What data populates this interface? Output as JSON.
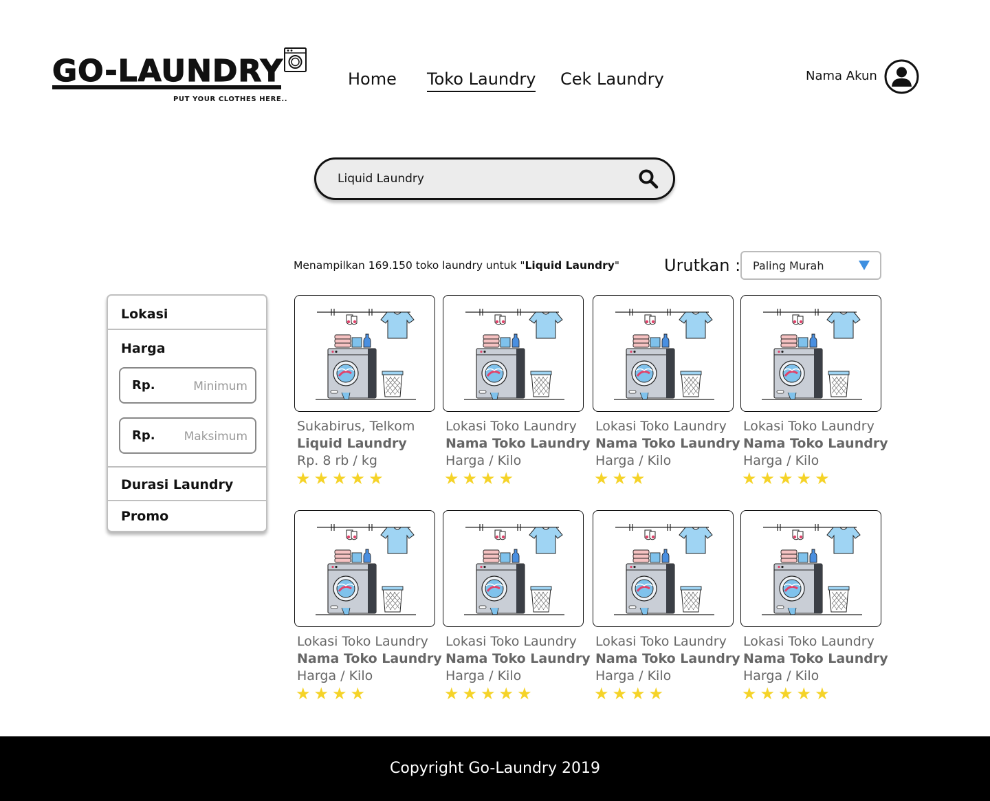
{
  "logo": {
    "brand": "GO-LAUNDRY",
    "tagline": "PUT YOUR CLOTHES HERE.."
  },
  "nav": {
    "items": [
      {
        "label": "Home",
        "active": false
      },
      {
        "label": "Toko Laundry",
        "active": true
      },
      {
        "label": "Cek Laundry",
        "active": false
      }
    ]
  },
  "account": {
    "name": "Nama Akun",
    "icon": "user-circle-icon"
  },
  "search": {
    "value": "Liquid Laundry",
    "icon": "search-icon"
  },
  "results": {
    "prefix": "Menampilkan 169.150 toko laundry untuk \"",
    "query": "Liquid Laundry",
    "suffix": "\""
  },
  "sort": {
    "label": "Urutkan :",
    "selected": "Paling Murah",
    "caret_color": "#3d8fe0"
  },
  "filters": {
    "lokasi": "Lokasi",
    "harga": "Harga",
    "min_prefix": "Rp.",
    "min_placeholder": "Minimum",
    "max_prefix": "Rp.",
    "max_placeholder": "Maksimum",
    "durasi": "Durasi Laundry",
    "promo": "Promo"
  },
  "cards": [
    {
      "location": "Sukabirus, Telkom",
      "name": "Liquid Laundry",
      "price": "Rp. 8 rb / kg",
      "rating": 5
    },
    {
      "location": "Lokasi Toko Laundry",
      "name": "Nama Toko Laundry",
      "price": "Harga / Kilo",
      "rating": 4
    },
    {
      "location": "Lokasi Toko Laundry",
      "name": "Nama Toko Laundry",
      "price": "Harga / Kilo",
      "rating": 3
    },
    {
      "location": "Lokasi Toko Laundry",
      "name": "Nama Toko Laundry",
      "price": "Harga / Kilo",
      "rating": 5
    },
    {
      "location": "Lokasi Toko Laundry",
      "name": "Nama Toko Laundry",
      "price": "Harga / Kilo",
      "rating": 4
    },
    {
      "location": "Lokasi Toko Laundry",
      "name": "Nama Toko Laundry",
      "price": "Harga / Kilo",
      "rating": 5
    },
    {
      "location": "Lokasi Toko Laundry",
      "name": "Nama Toko Laundry",
      "price": "Harga / Kilo",
      "rating": 4
    },
    {
      "location": "Lokasi Toko Laundry",
      "name": "Nama Toko Laundry",
      "price": "Harga / Kilo",
      "rating": 5
    }
  ],
  "colors": {
    "star": "#f5d328",
    "card_text": "#666666",
    "footer_bg": "#000000"
  },
  "footer": {
    "copyright": "Copyright Go-Laundry 2019"
  }
}
